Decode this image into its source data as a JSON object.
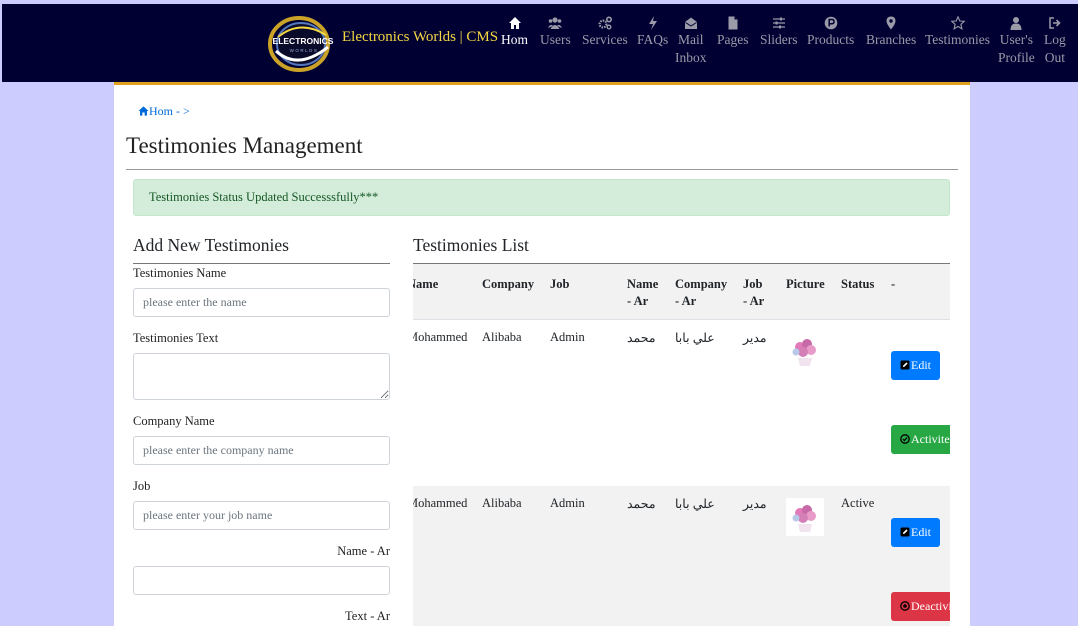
{
  "navbar": {
    "brand": "Electronics Worlds | CMS",
    "logo_text": "ELECTRONICS",
    "logo_subtext": "WORLDS",
    "items": [
      {
        "label": "Hom",
        "icon": "home-icon"
      },
      {
        "label": "Users",
        "icon": "users-icon"
      },
      {
        "label": "Services",
        "icon": "cogs-icon"
      },
      {
        "label": "FAQs",
        "icon": "bolt-icon"
      },
      {
        "label": "Mail Inbox",
        "line1": "Mail",
        "line2": "Inbox",
        "icon": "envelope-open-icon"
      },
      {
        "label": "Pages",
        "icon": "file-icon"
      },
      {
        "label": "Sliders",
        "icon": "sliders-icon"
      },
      {
        "label": "Products",
        "icon": "product-hunt-icon"
      },
      {
        "label": "Branches",
        "icon": "map-marker-icon"
      },
      {
        "label": "Testimonies",
        "icon": "star-icon"
      },
      {
        "label": "User's Profile",
        "line1": "User's",
        "line2": "Profile",
        "icon": "user-icon"
      },
      {
        "label": "Log Out",
        "line1": "Log",
        "line2": "Out",
        "icon": "sign-out-icon"
      }
    ]
  },
  "breadcrumb": {
    "home": "Hom",
    "separator": "- >"
  },
  "page_title": "Testimonies Management",
  "alert": {
    "text": "Testimonies Status Updated Successsfully***"
  },
  "form": {
    "title": "Add New Testimonies",
    "fields": {
      "name": {
        "label": "Testimonies Name",
        "placeholder": "please enter the name",
        "value": ""
      },
      "text": {
        "label": "Testimonies Text",
        "value": ""
      },
      "company": {
        "label": "Company Name",
        "placeholder": "please enter the company name",
        "value": ""
      },
      "job": {
        "label": "Job",
        "placeholder": "please enter your job name",
        "value": ""
      },
      "name_ar": {
        "label": "Name - Ar",
        "value": ""
      },
      "text_ar": {
        "label": "Text - Ar"
      }
    }
  },
  "list": {
    "title": "Testimonies List",
    "columns": {
      "name": "Name",
      "company": "Company",
      "job": "Job",
      "name_ar_1": "Name",
      "name_ar_2": "- Ar",
      "company_ar_1": "Company",
      "company_ar_2": "- Ar",
      "job_ar_1": "Job",
      "job_ar_2": "- Ar",
      "picture": "Picture",
      "status": "Status",
      "actions": "-"
    },
    "rows": [
      {
        "name": "Mohammed",
        "company": "Alibaba",
        "job": "Admin",
        "name_ar": "محمد",
        "company_ar": "علي بابا",
        "job_ar": "مدير",
        "status": "",
        "edit_label": "Edit",
        "toggle_label": "Activite"
      },
      {
        "name": "Mohammed",
        "company": "Alibaba",
        "job": "Admin",
        "name_ar": "محمد",
        "company_ar": "علي بابا",
        "job_ar": "مدير",
        "status": "Active",
        "edit_label": "Edit",
        "toggle_label": "Deactivite"
      }
    ]
  },
  "colors": {
    "navbar_bg": "#000033",
    "page_bg": "#ccccff",
    "brand": "#f5d742",
    "accent": "#e0a020",
    "edit_button": "#007bff",
    "activate_button": "#28a745",
    "deactivate_button": "#dc3545",
    "alert_bg": "#d4edda"
  }
}
